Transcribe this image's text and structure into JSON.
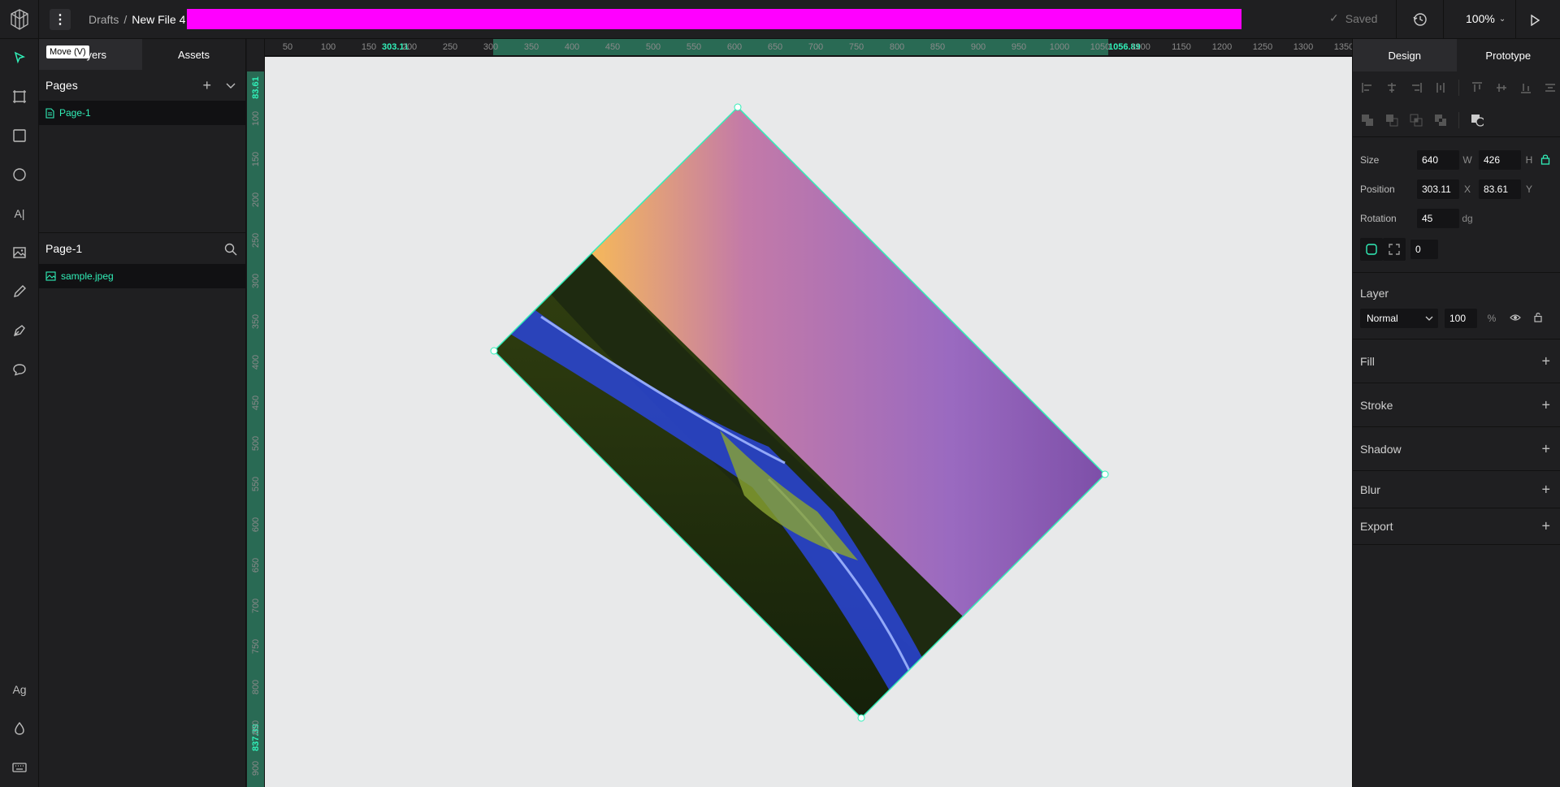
{
  "header": {
    "breadcrumb_parent": "Drafts",
    "breadcrumb_sep": "/",
    "file_name": "New File 4",
    "saved_label": "Saved",
    "zoom": "100%"
  },
  "toolbar": {
    "tooltip": "Move (V)",
    "text_tool": "A|",
    "typography_tool": "Ag"
  },
  "left_panel": {
    "tabs": [
      "Layers",
      "Assets"
    ],
    "pages_title": "Pages",
    "pages": [
      "Page-1"
    ],
    "layers_title": "Page-1",
    "layers": [
      "sample.jpeg"
    ]
  },
  "rulers": {
    "top_ticks": [
      "50",
      "100",
      "150",
      "200",
      "250",
      "300",
      "350",
      "400",
      "450",
      "500",
      "550",
      "600",
      "650",
      "700",
      "750",
      "800",
      "850",
      "900",
      "950",
      "1000",
      "1050",
      "1100",
      "1150",
      "1200",
      "1250",
      "1300",
      "1350"
    ],
    "left_ticks": [
      "100",
      "150",
      "200",
      "250",
      "300",
      "350",
      "400",
      "450",
      "500",
      "550",
      "600",
      "650",
      "700",
      "750",
      "800",
      "850",
      "900"
    ],
    "sel_x_start": "303.11",
    "sel_x_end": "1056.89",
    "sel_y_start": "83.61",
    "sel_y_end": "837.39"
  },
  "right_panel": {
    "tabs": [
      "Design",
      "Prototype"
    ],
    "size_label": "Size",
    "width": "640",
    "width_unit": "W",
    "height": "426",
    "height_unit": "H",
    "position_label": "Position",
    "pos_x": "303.11",
    "pos_x_unit": "X",
    "pos_y": "83.61",
    "pos_y_unit": "Y",
    "rotation_label": "Rotation",
    "rotation": "45",
    "rotation_unit": "dg",
    "radius": "0",
    "layer_label": "Layer",
    "blend_mode": "Normal",
    "opacity": "100",
    "opacity_unit": "%",
    "sections": [
      "Fill",
      "Stroke",
      "Shadow",
      "Blur",
      "Export"
    ]
  },
  "colors": {
    "accent": "#31efb8",
    "header_bar": "#ff00ff",
    "canvas": "#e8e9ea",
    "panel": "#1f1f21"
  }
}
